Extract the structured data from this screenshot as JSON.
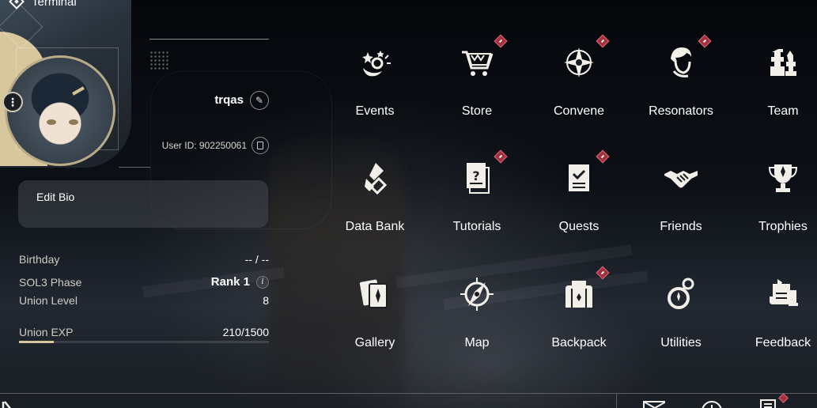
{
  "header": {
    "title": "Terminal"
  },
  "profile": {
    "username": "trqas",
    "user_id_label": "User ID: 902250061",
    "bio_label": "Edit Bio",
    "stats": [
      {
        "label": "Birthday",
        "value": "-- / --"
      },
      {
        "label": "SOL3 Phase",
        "value": "Rank 1"
      },
      {
        "label": "Union Level",
        "value": "8"
      },
      {
        "label": "Union EXP",
        "value": "210/1500"
      }
    ],
    "union_exp_progress": 0.14
  },
  "menu": {
    "items": [
      {
        "label": "Events",
        "icon": "events-icon",
        "badge": false
      },
      {
        "label": "Store",
        "icon": "store-cart-icon",
        "badge": true
      },
      {
        "label": "Convene",
        "icon": "convene-star-icon",
        "badge": true
      },
      {
        "label": "Resonators",
        "icon": "resonator-portrait-icon",
        "badge": true
      },
      {
        "label": "Team",
        "icon": "team-chess-icon",
        "badge": false
      },
      {
        "label": "Data Bank",
        "icon": "data-bank-icon",
        "badge": false
      },
      {
        "label": "Tutorials",
        "icon": "tutorials-icon",
        "badge": true
      },
      {
        "label": "Quests",
        "icon": "quests-icon",
        "badge": true
      },
      {
        "label": "Friends",
        "icon": "friends-handshake-icon",
        "badge": false
      },
      {
        "label": "Trophies",
        "icon": "trophy-icon",
        "badge": false
      },
      {
        "label": "Gallery",
        "icon": "gallery-cards-icon",
        "badge": false
      },
      {
        "label": "Map",
        "icon": "map-compass-icon",
        "badge": false
      },
      {
        "label": "Backpack",
        "icon": "backpack-icon",
        "badge": true
      },
      {
        "label": "Utilities",
        "icon": "utilities-icon",
        "badge": false
      },
      {
        "label": "Feedback",
        "icon": "feedback-icon",
        "badge": false
      }
    ]
  },
  "bottom_bar": {
    "icons": [
      "play-icon",
      "mail-icon",
      "clock-icon",
      "notes-icon"
    ],
    "notes_badge": true
  },
  "colors": {
    "accent_gold": "#d8c79d",
    "badge_red": "#a3303d",
    "panel": "#5a5e64"
  }
}
